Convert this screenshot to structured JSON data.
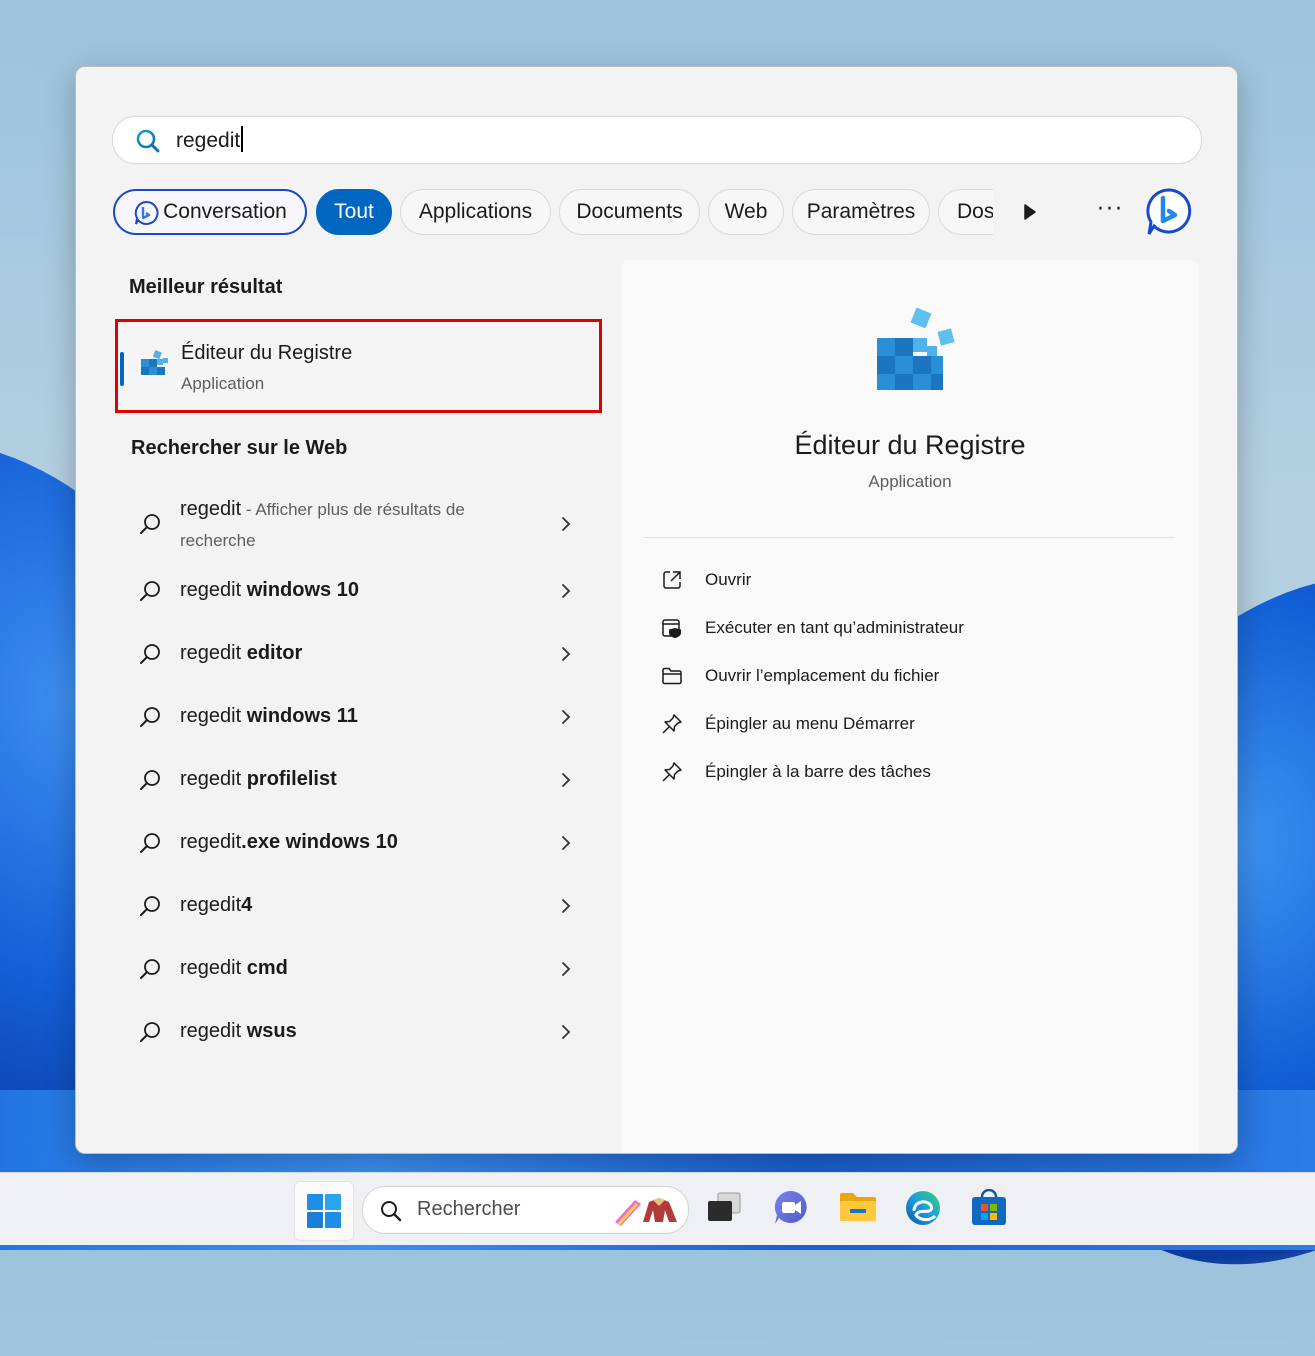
{
  "search": {
    "query": "regedit"
  },
  "filters": {
    "chips": [
      "Conversation",
      "Tout",
      "Applications",
      "Documents",
      "Web",
      "Paramètres",
      "Dos"
    ],
    "active": "Tout",
    "more": "···"
  },
  "best_match": {
    "heading": "Meilleur résultat",
    "name": "Éditeur du Registre",
    "kind": "Application"
  },
  "web": {
    "heading": "Rechercher sur le Web",
    "first": {
      "term": "regedit",
      "suffix": " - Afficher plus de résultats de",
      "suffix2": "recherche"
    },
    "items": [
      {
        "plain": "regedit",
        "bold": " windows 10"
      },
      {
        "plain": "regedit",
        "bold": " editor"
      },
      {
        "plain": "regedit",
        "bold": " windows 11"
      },
      {
        "plain": "regedit",
        "bold": " profilelist"
      },
      {
        "plain": "regedit",
        "bold": ".exe windows 10"
      },
      {
        "plain": "regedit",
        "bold": "4"
      },
      {
        "plain": "regedit",
        "bold": " cmd"
      },
      {
        "plain": "regedit",
        "bold": " wsus"
      }
    ]
  },
  "details": {
    "name": "Éditeur du Registre",
    "kind": "Application",
    "actions": [
      {
        "label": "Ouvrir",
        "icon": "open-external-icon"
      },
      {
        "label": "Exécuter en tant qu’administrateur",
        "icon": "admin-shield-icon"
      },
      {
        "label": "Ouvrir l’emplacement du fichier",
        "icon": "folder-icon"
      },
      {
        "label": "Épingler au menu Démarrer",
        "icon": "pin-icon"
      },
      {
        "label": "Épingler à la barre des tâches",
        "icon": "pin-icon"
      }
    ]
  },
  "taskbar": {
    "search_placeholder": "Rechercher",
    "apps": [
      "task-view-icon",
      "teams-icon",
      "file-explorer-icon",
      "edge-icon",
      "store-icon"
    ]
  },
  "colors": {
    "accent": "#0067c0",
    "highlight_border": "#e00000",
    "bing_blue": "#1a49c9"
  }
}
